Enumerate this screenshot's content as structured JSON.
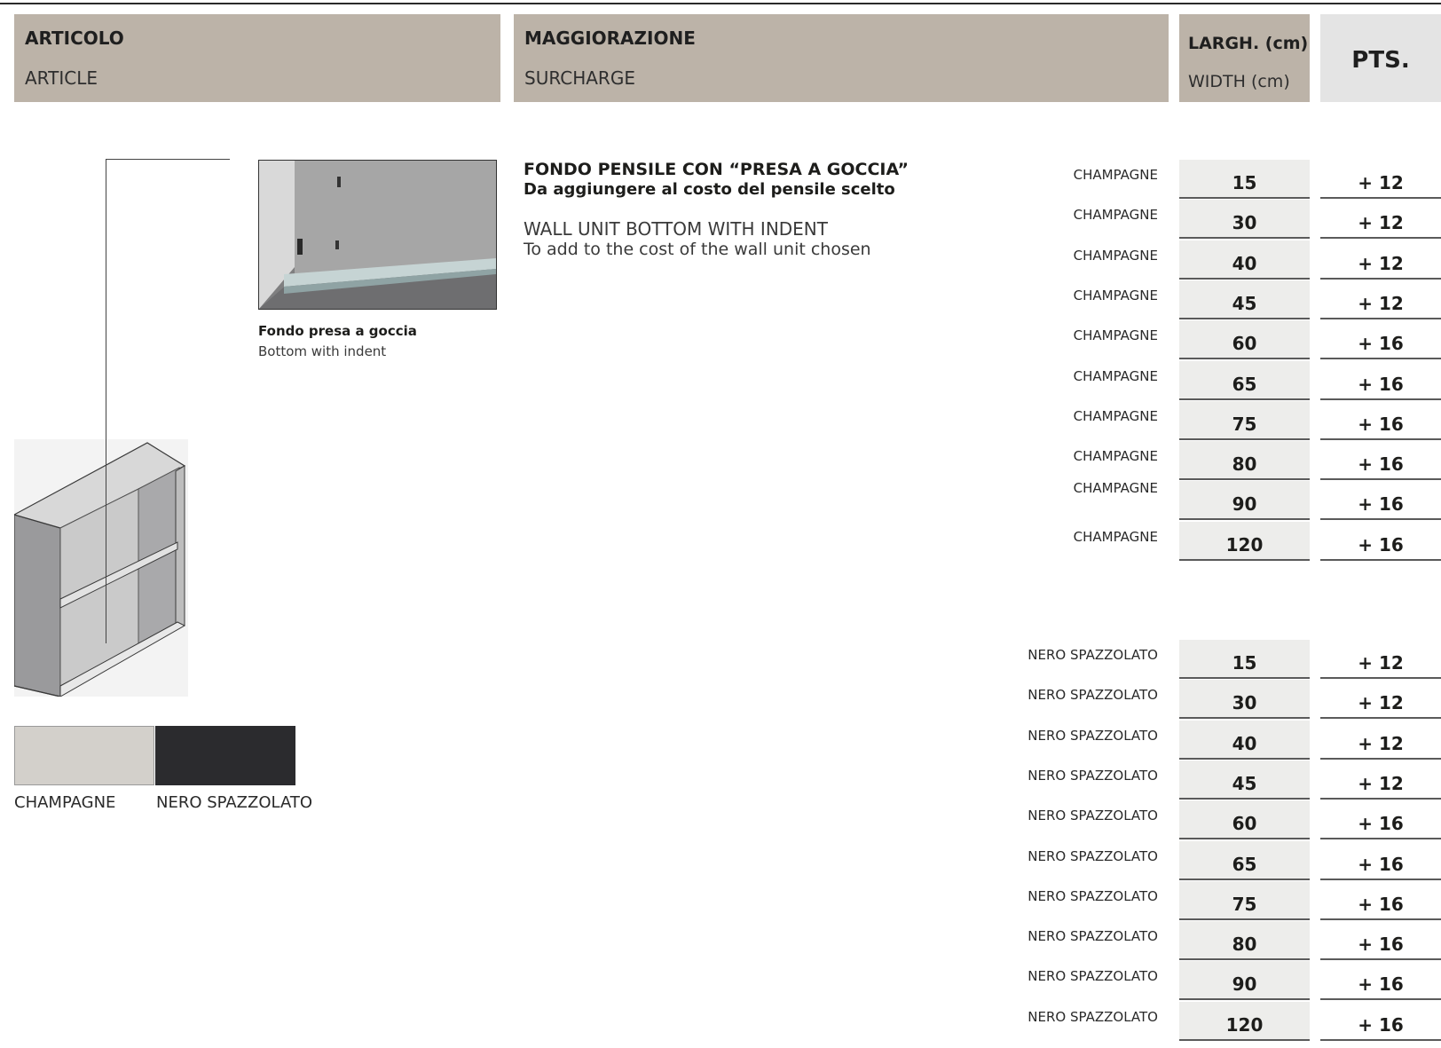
{
  "header": {
    "article": {
      "it": "ARTICOLO",
      "en": "ARTICLE"
    },
    "surcharge": {
      "it": "MAGGIORAZIONE",
      "en": "SURCHARGE"
    },
    "width": {
      "it": "LARGH. (cm)",
      "en": "WIDTH (cm)"
    },
    "points": "PTS."
  },
  "product": {
    "title_it": "FONDO PENSILE CON “PRESA A GOCCIA”",
    "subtitle_it": "Da aggiungere al costo del pensile scelto",
    "title_en": "WALL UNIT BOTTOM WITH INDENT",
    "subtitle_en": "To add to the cost of the wall unit chosen"
  },
  "photo_caption": {
    "it": "Fondo presa a goccia",
    "en": "Bottom with indent"
  },
  "swatches": [
    {
      "label": "CHAMPAGNE",
      "color": "#d3d0cb"
    },
    {
      "label": "NERO SPAZZOLATO",
      "color": "#2b2b2e"
    }
  ],
  "price_groups": [
    {
      "finish": "CHAMPAGNE",
      "rows": [
        {
          "finish": "CHAMPAGNE",
          "width": "15",
          "pts": "+ 12"
        },
        {
          "finish": "CHAMPAGNE",
          "width": "30",
          "pts": "+ 12"
        },
        {
          "finish": "CHAMPAGNE",
          "width": "40",
          "pts": "+ 12"
        },
        {
          "finish": "CHAMPAGNE",
          "width": "45",
          "pts": "+ 12"
        },
        {
          "finish": "CHAMPAGNE",
          "width": "60",
          "pts": "+ 16"
        },
        {
          "finish": "CHAMPAGNE",
          "width": "65",
          "pts": "+ 16"
        },
        {
          "finish": "CHAMPAGNE",
          "width": "75",
          "pts": "+ 16"
        },
        {
          "finish": "CHAMPAGNE",
          "width": "80",
          "pts": "+ 16"
        },
        {
          "finish": "CHAMPAGNE",
          "width": "90",
          "pts": "+ 16"
        },
        {
          "finish": "CHAMPAGNE",
          "width": "120",
          "pts": "+ 16"
        }
      ]
    },
    {
      "finish": "NERO SPAZZOLATO",
      "rows": [
        {
          "finish": "NERO SPAZZOLATO",
          "width": "15",
          "pts": "+ 12"
        },
        {
          "finish": "NERO SPAZZOLATO",
          "width": "30",
          "pts": "+ 12"
        },
        {
          "finish": "NERO SPAZZOLATO",
          "width": "40",
          "pts": "+ 12"
        },
        {
          "finish": "NERO SPAZZOLATO",
          "width": "45",
          "pts": "+ 12"
        },
        {
          "finish": "NERO SPAZZOLATO",
          "width": "60",
          "pts": "+ 16"
        },
        {
          "finish": "NERO SPAZZOLATO",
          "width": "65",
          "pts": "+ 16"
        },
        {
          "finish": "NERO SPAZZOLATO",
          "width": "75",
          "pts": "+ 16"
        },
        {
          "finish": "NERO SPAZZOLATO",
          "width": "80",
          "pts": "+ 16"
        },
        {
          "finish": "NERO SPAZZOLATO",
          "width": "90",
          "pts": "+ 16"
        },
        {
          "finish": "NERO SPAZZOLATO",
          "width": "120",
          "pts": "+ 16"
        }
      ]
    }
  ]
}
